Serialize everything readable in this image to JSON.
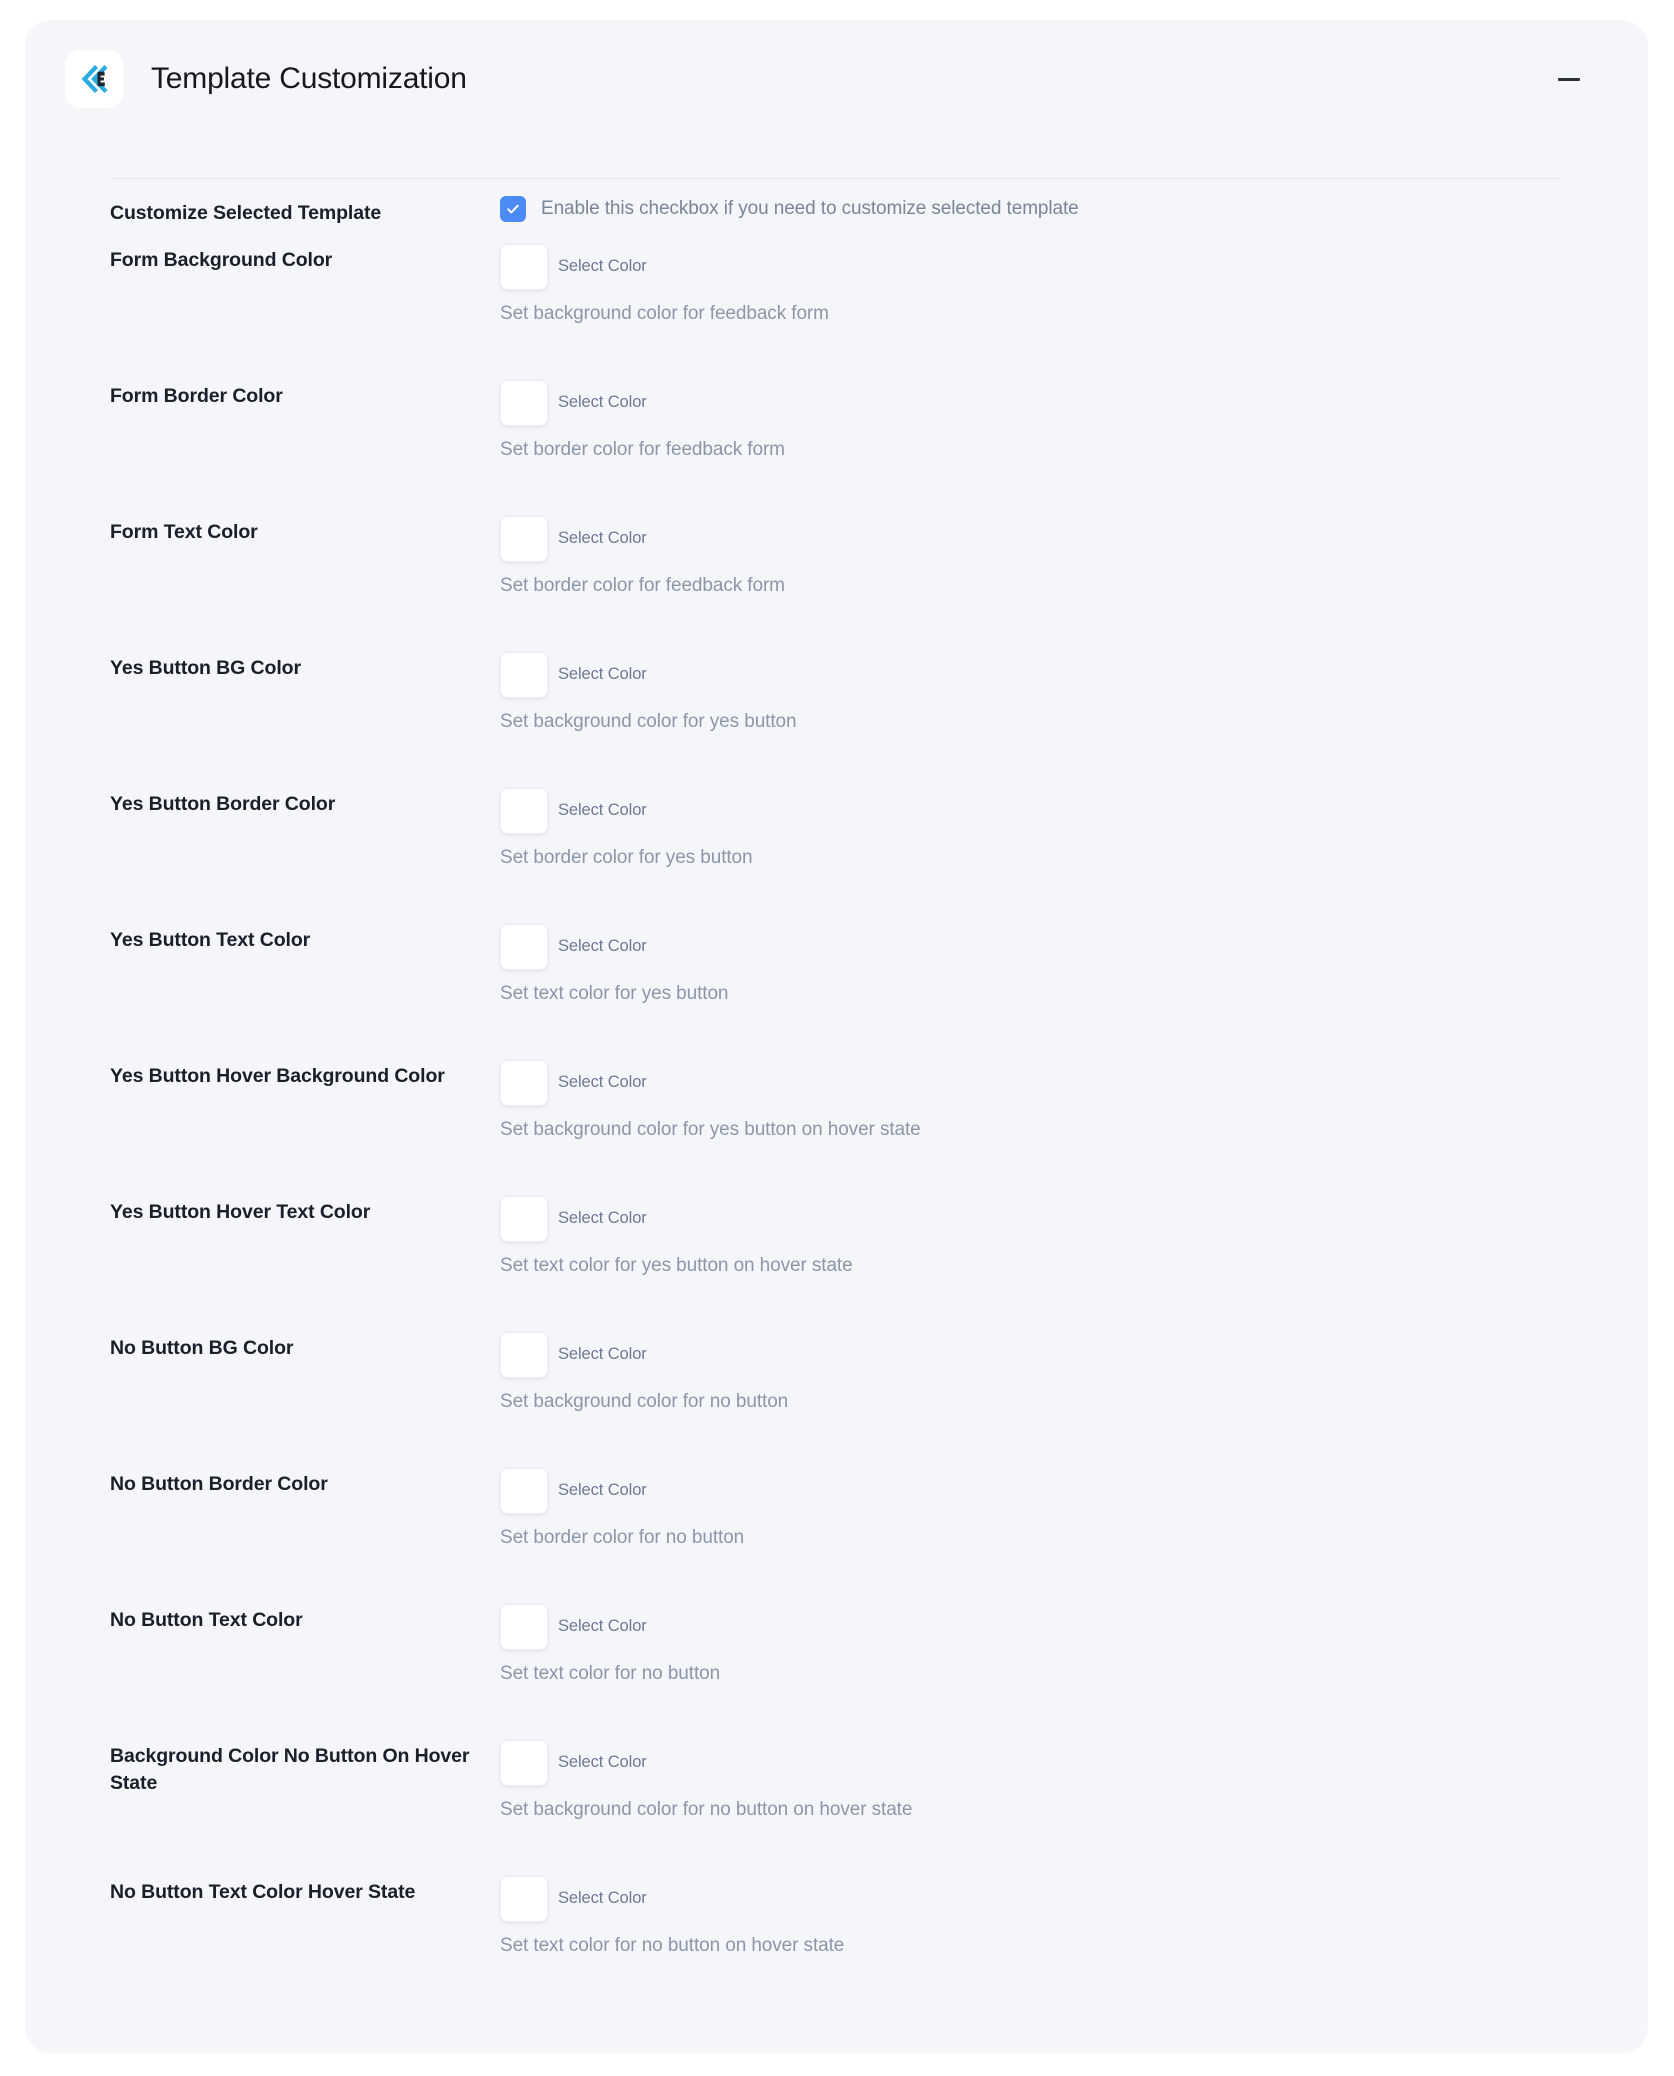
{
  "panel": {
    "title": "Template Customization",
    "logo_icon": "double-chevron-left-logo-icon",
    "collapse_icon": "minus-icon"
  },
  "checkbox_row": {
    "label": "Customize Selected Template",
    "checked": true,
    "check_icon": "checkmark-icon",
    "description": "Enable this checkbox if you need to customize selected template"
  },
  "select_color_label": "Select Color",
  "colors": {
    "accent": "#4c8bf5",
    "panel_bg": "#f4f6fa",
    "page_bg": "#ffffff",
    "label_text": "#1b1f27",
    "muted_text": "#8d96a8",
    "swatch_fill": "#ffffff",
    "divider": "#e4e8ef"
  },
  "rows": [
    {
      "label": "Form Background Color",
      "swatch_label": "Select Color",
      "swatch_color": "#ffffff",
      "description": "Set background color for feedback form"
    },
    {
      "label": "Form Border Color",
      "swatch_label": "Select Color",
      "swatch_color": "#ffffff",
      "description": "Set border color for feedback form"
    },
    {
      "label": "Form Text Color",
      "swatch_label": "Select Color",
      "swatch_color": "#ffffff",
      "description": "Set border color for feedback form"
    },
    {
      "label": "Yes Button BG Color",
      "swatch_label": "Select Color",
      "swatch_color": "#ffffff",
      "description": "Set background color for yes button"
    },
    {
      "label": "Yes Button Border Color",
      "swatch_label": "Select Color",
      "swatch_color": "#ffffff",
      "description": "Set border color for yes button"
    },
    {
      "label": "Yes Button Text Color",
      "swatch_label": "Select Color",
      "swatch_color": "#ffffff",
      "description": "Set text color for yes button"
    },
    {
      "label": "Yes Button Hover Background Color",
      "swatch_label": "Select Color",
      "swatch_color": "#ffffff",
      "description": "Set background color for yes button on hover state"
    },
    {
      "label": "Yes Button Hover Text Color",
      "swatch_label": "Select Color",
      "swatch_color": "#ffffff",
      "description": "Set text color for yes button on hover state"
    },
    {
      "label": "No Button BG Color",
      "swatch_label": "Select Color",
      "swatch_color": "#ffffff",
      "description": "Set background color for no button"
    },
    {
      "label": "No Button Border Color",
      "swatch_label": "Select Color",
      "swatch_color": "#ffffff",
      "description": "Set border color for no button"
    },
    {
      "label": "No Button Text Color",
      "swatch_label": "Select Color",
      "swatch_color": "#ffffff",
      "description": "Set text color for no button"
    },
    {
      "label": "Background Color No Button On Hover State",
      "swatch_label": "Select Color",
      "swatch_color": "#ffffff",
      "description": "Set background color for no button on hover state"
    },
    {
      "label": "No Button Text Color Hover State",
      "swatch_label": "Select Color",
      "swatch_color": "#ffffff",
      "description": "Set text color for no button on hover state"
    }
  ]
}
